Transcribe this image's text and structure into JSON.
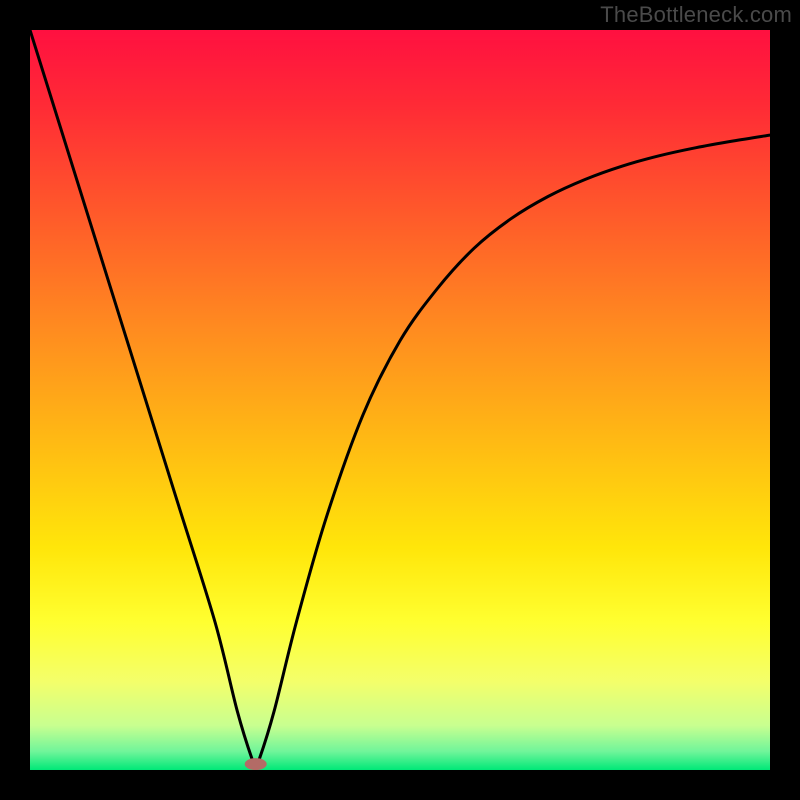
{
  "watermark": "TheBottleneck.com",
  "chart_data": {
    "type": "line",
    "title": "",
    "xlabel": "",
    "ylabel": "",
    "xlim": [
      0,
      100
    ],
    "ylim": [
      0,
      100
    ],
    "grid": false,
    "legend": false,
    "annotations": [],
    "series": [
      {
        "name": "curve",
        "x": [
          0,
          5,
          10,
          15,
          20,
          25,
          28,
          30,
          30.5,
          31,
          33,
          36,
          40,
          45,
          50,
          55,
          60,
          65,
          70,
          75,
          80,
          85,
          90,
          95,
          100
        ],
        "y": [
          100,
          84,
          68,
          52,
          36,
          20,
          8,
          1.5,
          0.8,
          1.5,
          8,
          20,
          34,
          48,
          58,
          65,
          70.5,
          74.5,
          77.5,
          79.8,
          81.6,
          83,
          84.1,
          85,
          85.8
        ]
      }
    ],
    "optimum_marker": {
      "x": 30.5,
      "y": 0.8,
      "color": "#b36b66"
    },
    "gradient_stops": [
      {
        "offset": 0.0,
        "color": "#ff1040"
      },
      {
        "offset": 0.1,
        "color": "#ff2a36"
      },
      {
        "offset": 0.25,
        "color": "#ff5a2a"
      },
      {
        "offset": 0.4,
        "color": "#ff8a20"
      },
      {
        "offset": 0.55,
        "color": "#ffb814"
      },
      {
        "offset": 0.7,
        "color": "#ffe60a"
      },
      {
        "offset": 0.8,
        "color": "#ffff30"
      },
      {
        "offset": 0.88,
        "color": "#f4ff6a"
      },
      {
        "offset": 0.94,
        "color": "#c8ff90"
      },
      {
        "offset": 0.975,
        "color": "#70f59a"
      },
      {
        "offset": 1.0,
        "color": "#00e878"
      }
    ]
  }
}
